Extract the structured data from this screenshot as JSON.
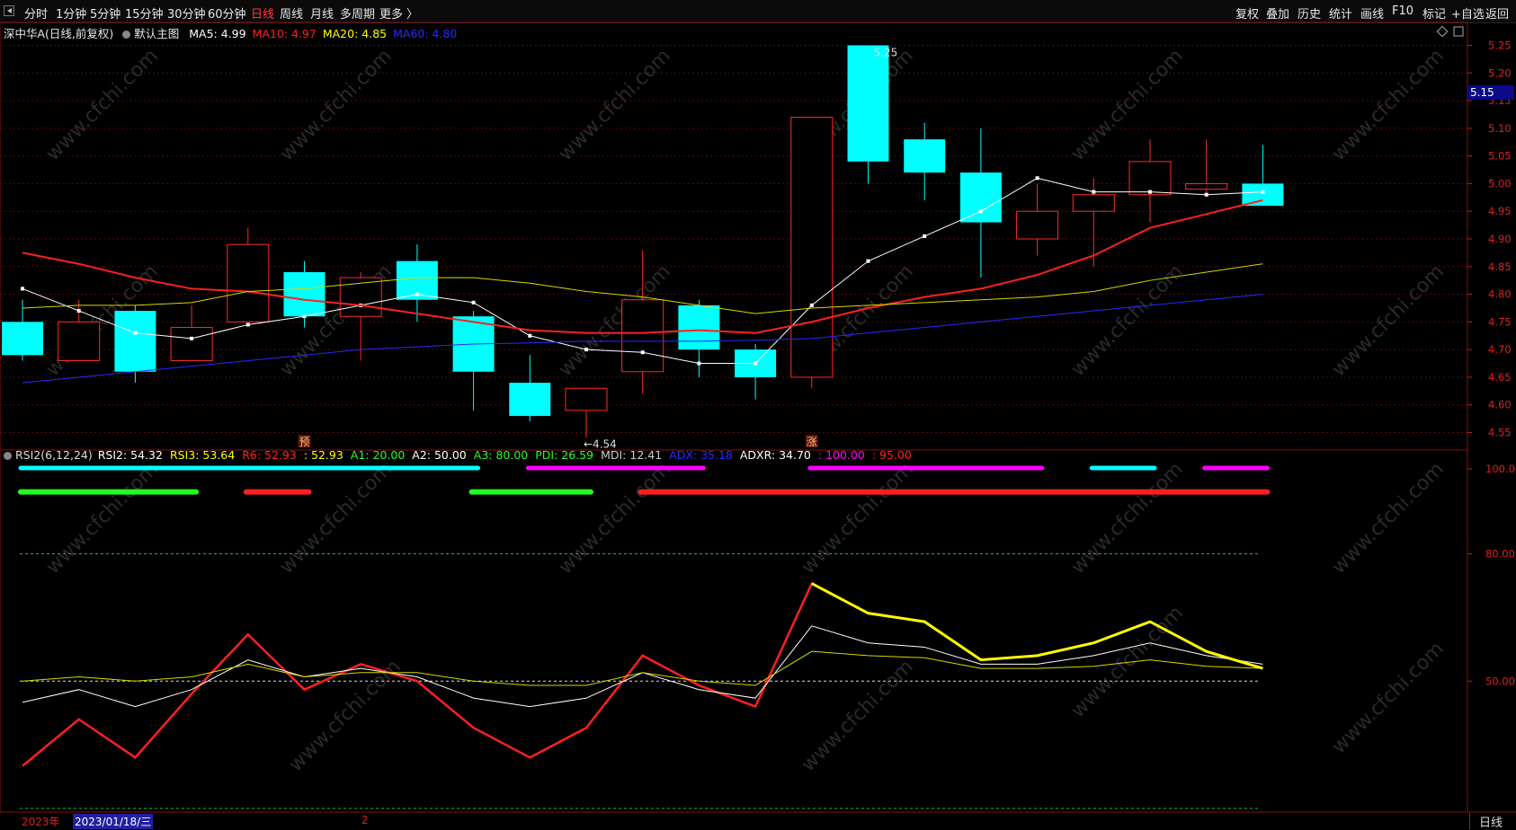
{
  "toolbar": {
    "periods": [
      "分时",
      "1分钟",
      "5分钟",
      "15分钟",
      "30分钟",
      "60分钟",
      "日线",
      "周线",
      "月线",
      "多周期",
      "更多 〉"
    ],
    "active_period": "日线",
    "right_buttons": [
      "复权",
      "叠加",
      "历史",
      "统计",
      "画线",
      "F10",
      "标记",
      "+自选",
      "返回"
    ]
  },
  "main_panel": {
    "title": "深中华A(日线,前复权)",
    "template": "默认主图",
    "ma_labels": [
      {
        "text": "MA5: 4.99",
        "color": "#ffffff"
      },
      {
        "text": "MA10: 4.97",
        "color": "#ff2020"
      },
      {
        "text": "MA20: 4.85",
        "color": "#ffff00"
      },
      {
        "text": "MA60: 4.80",
        "color": "#2a2aff"
      }
    ],
    "current_price_tag": "5.15",
    "high_annotation": "5.25",
    "low_annotation": "←4.54",
    "event_markers": [
      "预",
      "涨"
    ]
  },
  "rsi_panel": {
    "labels": [
      {
        "text": "RSI2(6,12,24)",
        "color": "#dddddd"
      },
      {
        "text": "RSI2: 54.32",
        "color": "#ffffff"
      },
      {
        "text": "RSI3: 53.64",
        "color": "#ffff00"
      },
      {
        "text": "R6: 52.93",
        "color": "#ff2020"
      },
      {
        "text": ": 52.93",
        "color": "#ffff00"
      },
      {
        "text": "A1: 20.00",
        "color": "#20ff20"
      },
      {
        "text": "A2: 50.00",
        "color": "#ffffff"
      },
      {
        "text": "A3: 80.00",
        "color": "#20ff20"
      },
      {
        "text": "PDI: 26.59",
        "color": "#20ff20"
      },
      {
        "text": "MDI: 12.41",
        "color": "#cccccc"
      },
      {
        "text": "ADX: 35.18",
        "color": "#2a2aff"
      },
      {
        "text": "ADXR: 34.70",
        "color": "#ffffff"
      },
      {
        "text": ": 100.00",
        "color": "#ff00ff"
      },
      {
        "text": ": 95.00",
        "color": "#ff2020"
      }
    ]
  },
  "footer": {
    "year": "2023年",
    "date": "2023/01/18/三",
    "month_mark": "2",
    "period_tab": "日线"
  },
  "watermark": "www.cfchi.com",
  "colors": {
    "up": "#ff2a2a",
    "down": "#00ffff",
    "ma5": "#ffffff",
    "ma10": "#ff2020",
    "ma20": "#d8d800",
    "ma60": "#2a2aff",
    "axis_text": "#e02020"
  },
  "chart_data": [
    {
      "type": "candlestick",
      "title": "深中华A(日线,前复权)",
      "ylim": [
        4.52,
        5.28
      ],
      "yticks": [
        4.55,
        4.6,
        4.65,
        4.7,
        4.75,
        4.8,
        4.85,
        4.9,
        4.95,
        5.0,
        5.05,
        5.1,
        5.15,
        5.2,
        5.25
      ],
      "candles": [
        {
          "o": 4.75,
          "h": 4.79,
          "l": 4.68,
          "c": 4.69
        },
        {
          "o": 4.68,
          "h": 4.79,
          "l": 4.68,
          "c": 4.75
        },
        {
          "o": 4.77,
          "h": 4.78,
          "l": 4.64,
          "c": 4.66
        },
        {
          "o": 4.68,
          "h": 4.78,
          "l": 4.68,
          "c": 4.74
        },
        {
          "o": 4.75,
          "h": 4.92,
          "l": 4.75,
          "c": 4.89
        },
        {
          "o": 4.84,
          "h": 4.86,
          "l": 4.74,
          "c": 4.76
        },
        {
          "o": 4.76,
          "h": 4.84,
          "l": 4.68,
          "c": 4.83
        },
        {
          "o": 4.86,
          "h": 4.89,
          "l": 4.75,
          "c": 4.79
        },
        {
          "o": 4.76,
          "h": 4.77,
          "l": 4.59,
          "c": 4.66
        },
        {
          "o": 4.64,
          "h": 4.69,
          "l": 4.57,
          "c": 4.58
        },
        {
          "o": 4.59,
          "h": 4.63,
          "l": 4.54,
          "c": 4.63
        },
        {
          "o": 4.66,
          "h": 4.88,
          "l": 4.62,
          "c": 4.79
        },
        {
          "o": 4.78,
          "h": 4.79,
          "l": 4.65,
          "c": 4.7
        },
        {
          "o": 4.7,
          "h": 4.71,
          "l": 4.61,
          "c": 4.65
        },
        {
          "o": 4.65,
          "h": 5.12,
          "l": 4.63,
          "c": 5.12
        },
        {
          "o": 5.25,
          "h": 5.25,
          "l": 5.0,
          "c": 5.04
        },
        {
          "o": 5.08,
          "h": 5.11,
          "l": 4.97,
          "c": 5.02
        },
        {
          "o": 5.02,
          "h": 5.1,
          "l": 4.83,
          "c": 4.93
        },
        {
          "o": 4.9,
          "h": 5.0,
          "l": 4.87,
          "c": 4.95
        },
        {
          "o": 4.95,
          "h": 5.01,
          "l": 4.85,
          "c": 4.98
        },
        {
          "o": 4.98,
          "h": 5.08,
          "l": 4.93,
          "c": 5.04
        },
        {
          "o": 4.99,
          "h": 5.08,
          "l": 4.98,
          "c": 5.0
        },
        {
          "o": 5.0,
          "h": 5.07,
          "l": 4.96,
          "c": 4.96
        }
      ],
      "series": [
        {
          "name": "MA5",
          "color": "#ffffff",
          "values": [
            4.81,
            4.77,
            4.73,
            4.72,
            4.745,
            4.76,
            4.78,
            4.8,
            4.785,
            4.725,
            4.7,
            4.695,
            4.675,
            4.675,
            4.78,
            4.86,
            4.905,
            4.95,
            5.01,
            4.985,
            4.985,
            4.98,
            4.985
          ]
        },
        {
          "name": "MA10",
          "color": "#ff2020",
          "values": [
            4.875,
            4.855,
            4.83,
            4.81,
            4.805,
            4.79,
            4.78,
            4.765,
            4.75,
            4.735,
            4.73,
            4.73,
            4.735,
            4.73,
            4.75,
            4.775,
            4.795,
            4.81,
            4.835,
            4.87,
            4.92,
            4.945,
            4.97
          ]
        },
        {
          "name": "MA20",
          "color": "#d8d800",
          "values": [
            4.775,
            4.78,
            4.78,
            4.785,
            4.805,
            4.81,
            4.82,
            4.83,
            4.83,
            4.82,
            4.805,
            4.795,
            4.78,
            4.765,
            4.775,
            4.78,
            4.785,
            4.79,
            4.795,
            4.805,
            4.825,
            4.84,
            4.855
          ]
        },
        {
          "name": "MA60",
          "color": "#2a2aff",
          "values": [
            4.64,
            4.65,
            4.66,
            4.67,
            4.68,
            4.69,
            4.7,
            4.705,
            4.71,
            4.712,
            4.715,
            4.715,
            4.715,
            4.717,
            4.72,
            4.73,
            4.74,
            4.75,
            4.76,
            4.77,
            4.78,
            4.79,
            4.8
          ]
        }
      ]
    },
    {
      "type": "line",
      "title": "RSI2(6,12,24)",
      "ylim": [
        20,
        100
      ],
      "yticks": [
        50.0,
        80.0,
        100.0
      ],
      "hlines": [
        {
          "value": 80,
          "color": "#20c020",
          "dash": true
        },
        {
          "value": 50,
          "color": "#dddddd",
          "dash": true
        },
        {
          "value": 20,
          "color": "#20c020",
          "dash": true
        }
      ],
      "series": [
        {
          "name": "R6",
          "color": "#ff2020",
          "values": [
            30,
            41,
            32,
            47,
            61,
            48,
            54,
            50,
            39,
            32,
            39,
            56,
            49,
            44,
            73,
            66,
            64,
            55,
            56,
            59,
            64,
            57,
            53
          ]
        },
        {
          "name": "RSI2",
          "color": "#ffffff",
          "values": [
            45,
            48,
            44,
            48,
            55,
            51,
            53,
            51,
            46,
            44,
            46,
            52,
            48,
            46,
            63,
            59,
            58,
            54,
            54,
            56,
            59,
            56,
            54
          ]
        },
        {
          "name": "RSI3",
          "color": "#d8d800",
          "values": [
            50,
            51,
            50,
            51,
            54,
            51,
            52,
            52,
            50,
            49,
            49,
            52,
            50,
            49,
            57,
            56,
            55.5,
            53,
            53,
            53.5,
            55,
            53.5,
            53
          ]
        },
        {
          "name": "A3",
          "color": "#ffff00",
          "values": [
            null,
            null,
            null,
            null,
            null,
            null,
            null,
            null,
            null,
            null,
            null,
            null,
            null,
            null,
            73,
            66,
            64,
            55,
            56,
            59,
            64,
            57,
            53
          ]
        }
      ],
      "signal_bars": [
        {
          "color": "#00ffff",
          "from": 0,
          "to": 8,
          "level": 100
        },
        {
          "color": "#ff00ff",
          "from": 9,
          "to": 12,
          "level": 100
        },
        {
          "color": "#ff00ff",
          "from": 14,
          "to": 18,
          "level": 100
        },
        {
          "color": "#00ffff",
          "from": 19,
          "to": 20,
          "level": 100
        },
        {
          "color": "#ff00ff",
          "from": 21,
          "to": 22,
          "level": 100
        },
        {
          "color": "#20ff20",
          "from": 0,
          "to": 3,
          "level": 95
        },
        {
          "color": "#ff2020",
          "from": 4,
          "to": 5,
          "level": 95
        },
        {
          "color": "#20ff20",
          "from": 8,
          "to": 10,
          "level": 95
        },
        {
          "color": "#ff2020",
          "from": 11,
          "to": 22,
          "level": 95
        }
      ]
    }
  ]
}
